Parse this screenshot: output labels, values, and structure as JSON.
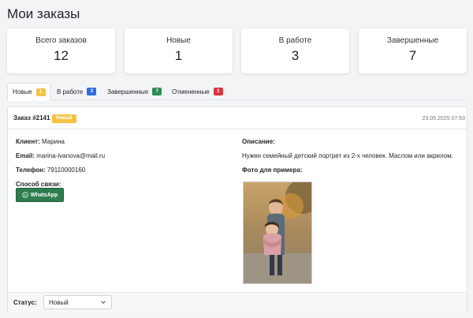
{
  "page": {
    "title": "Мои заказы"
  },
  "stats": [
    {
      "label": "Всего заказов",
      "value": "12"
    },
    {
      "label": "Новые",
      "value": "1"
    },
    {
      "label": "В работе",
      "value": "3"
    },
    {
      "label": "Завершенные",
      "value": "7"
    }
  ],
  "tabs": [
    {
      "label": "Новые",
      "count": "1",
      "color": "#f5c242"
    },
    {
      "label": "В работе",
      "count": "3",
      "color": "#2f6de1"
    },
    {
      "label": "Завершенные",
      "count": "7",
      "color": "#2e8b57"
    },
    {
      "label": "Отмененные",
      "count": "1",
      "color": "#d9363e"
    }
  ],
  "order": {
    "number": "Заказ #2141",
    "status_badge": "Новый",
    "date": "23.05.2025 07:53",
    "client_label": "Клиент:",
    "client": "Марина",
    "email_label": "Email:",
    "email": "marina-ivanova@mail.ru",
    "phone_label": "Телефон:",
    "phone": "79110000160",
    "contact_label": "Способ связи:",
    "contact_button": "WhatsApp",
    "description_label": "Описание:",
    "description": "Нужен семейный детский портрет из 2-х человек. Маслом или акрилом.",
    "photo_label": "Фото для примера:",
    "status_label": "Статус:",
    "status_value": "Новый"
  }
}
